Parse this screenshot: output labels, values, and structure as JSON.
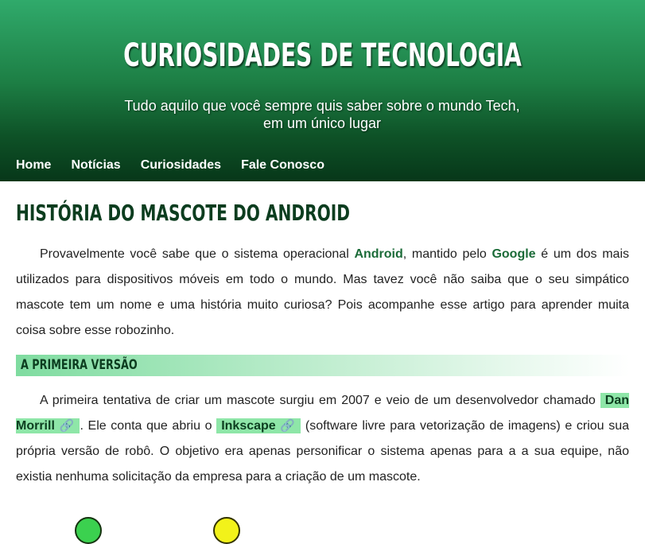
{
  "header": {
    "title": "CURIOSIDADES DE TECNOLOGIA",
    "subtitle": "Tudo aquilo que você sempre quis saber sobre o mundo Tech, em um único lugar"
  },
  "nav": {
    "items": [
      {
        "label": "Home"
      },
      {
        "label": "Notícias"
      },
      {
        "label": "Curiosidades"
      },
      {
        "label": "Fale Conosco"
      }
    ]
  },
  "article": {
    "title": "HISTÓRIA DO MASCOTE DO ANDROID",
    "intro": {
      "t1": "Provavelmente você sabe que o sistema operacional ",
      "android": "Android",
      "t2": ", mantido pelo ",
      "google": "Google",
      "t3": " é um dos mais utilizados para dispositivos móveis em todo o mundo. Mas tavez você não saiba que o seu simpático mascote tem um nome e uma história muito curiosa? Pois acompanhe esse artigo para aprender muita coisa sobre esse robozinho."
    },
    "section1": {
      "title": "A PRIMEIRA VERSÃO",
      "t1": "A primeira tentativa de criar um mascote surgiu em 2007 e veio de um desenvolvedor chamado ",
      "link1": "Dan Morrill",
      "t2": ". Ele conta que abriu o ",
      "link2": "Inkscape",
      "t3": " (software livre para vetorização de imagens) e criou sua própria versão de robô. O objetivo era apenas personificar o sistema apenas para a a sua equipe, não existia nenhuma solicitação da empresa para a criação de um mascote.",
      "link_icon": "🔗"
    }
  },
  "colors": {
    "header_top": "#30aa6b",
    "header_bottom": "#073719",
    "title_dark_green": "#0c3d1f",
    "highlight": "#8ee6a8"
  }
}
